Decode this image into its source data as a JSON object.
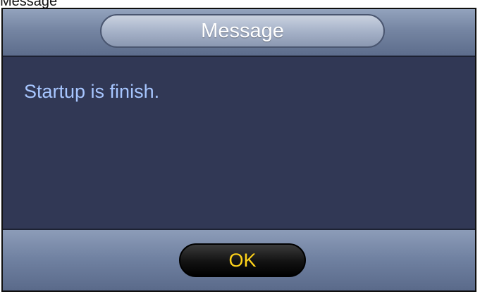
{
  "page_title_partial": "Message",
  "dialog": {
    "title": "Message",
    "message": "Startup is finish.",
    "ok_label": "OK"
  },
  "colors": {
    "body_bg": "#313855",
    "message_text": "#a7c6ff",
    "ok_text": "#ffd31a"
  }
}
